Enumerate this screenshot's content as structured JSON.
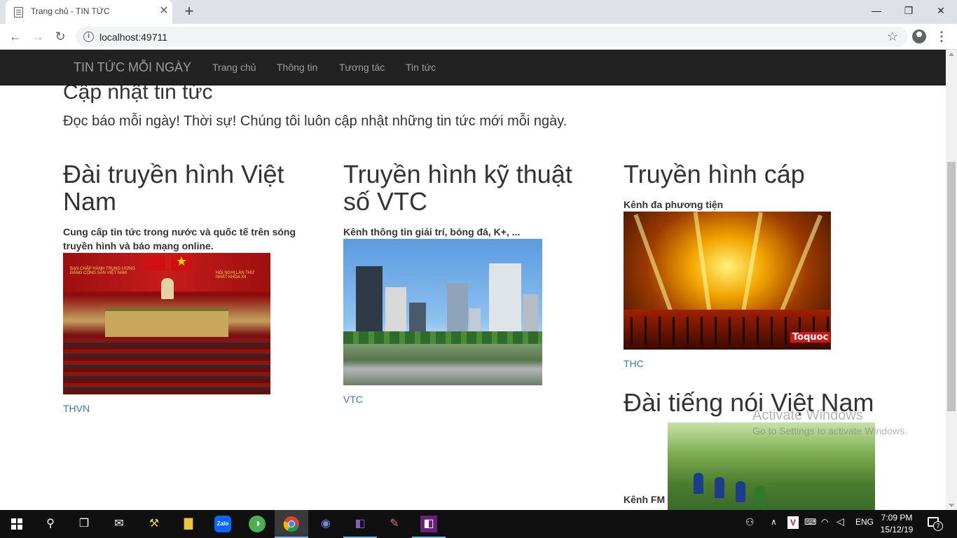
{
  "browser": {
    "tab_title": "Trang chủ - TIN TỨC",
    "url": "localhost:49711"
  },
  "navbar": {
    "brand": "TIN TỨC MỖI NGÀY",
    "links": [
      "Trang chủ",
      "Thông tin",
      "Tương tác",
      "Tin tức"
    ]
  },
  "jumbotron": {
    "title": "Cập nhật tin tức",
    "lead": "Đọc báo mỗi ngày! Thời sự! Chúng tôi luôn cập nhật những tin tức mới mỗi ngày."
  },
  "cards": [
    {
      "title_line1": "Đài truyền hình Việt",
      "title_line2": "Nam",
      "desc_line1": "Cung cấp tin tức trong nước và quốc tế trên sóng",
      "desc_line2": "truyền hình và báo mạng online.",
      "link": "THVN",
      "image_text1": "BAN CHẤP HÀNH TRUNG ƯƠNG ĐẢNG CỘNG SẢN VIỆT NAM",
      "image_text2": "HỘI NGHỊ LẦN THỨ NHẤT KHÓA XII"
    },
    {
      "title_line1": "Truyền hình kỹ thuật",
      "title_line2": "số VTC",
      "desc": "Kênh thông tin giải trí, bóng đá, K+, ...",
      "link": "VTC"
    },
    {
      "title": "Truyền hình cáp",
      "desc": "Kênh đa phương tiện",
      "link": "THC",
      "image_logo": "Toquoc"
    },
    {
      "title": "Đài tiếng nói Việt Nam",
      "desc": "Kênh FM"
    }
  ],
  "watermark": {
    "line1": "Activate Windows",
    "line2": "Go to Settings to activate Windows."
  },
  "taskbar": {
    "apps": [
      "start",
      "search",
      "task-view",
      "mail",
      "tools",
      "file-explorer",
      "zalo",
      "coccoc",
      "chrome",
      "discord",
      "visual-studio",
      "paint",
      "visual-studio-2"
    ],
    "zalo_label": "Zalo",
    "lang": "ENG",
    "time": "7:09 PM",
    "date": "15/12/19",
    "notifications": "7"
  },
  "colors": {
    "navbar_bg": "#222222",
    "navbar_text": "#9d9d9d",
    "link": "#337ab7",
    "text": "#333333"
  }
}
